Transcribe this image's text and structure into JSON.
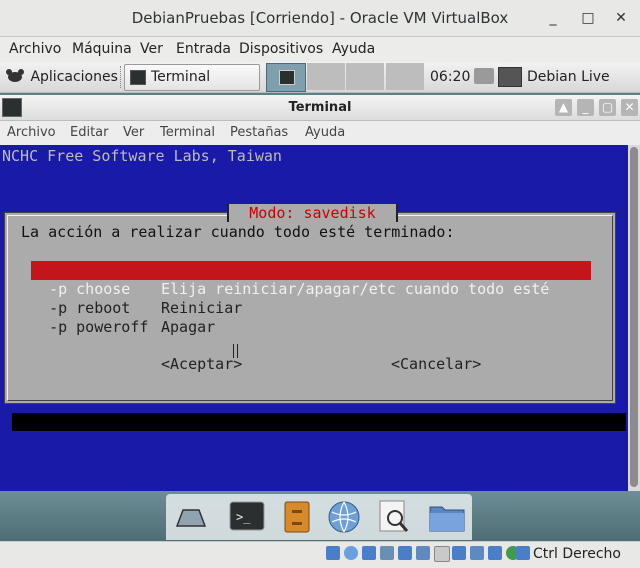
{
  "window": {
    "title": "DebianPruebas [Corriendo] - Oracle VM VirtualBox",
    "controls": [
      "_",
      "□",
      "✕"
    ]
  },
  "vbox_menu": [
    "Archivo",
    "Máquina",
    "Ver",
    "Entrada",
    "Dispositivos",
    "Ayuda"
  ],
  "panel": {
    "apps_label": "Aplicaciones",
    "task_label": "Terminal",
    "clock": "06:20",
    "user": "Debian Live user"
  },
  "terminal": {
    "title": "Terminal",
    "menu": [
      "Archivo",
      "Editar",
      "Ver",
      "Terminal",
      "Pestañas",
      "Ayuda"
    ]
  },
  "content": {
    "banner": "NCHC Free Software Labs, Taiwan",
    "dialog_title": "Modo: savedisk",
    "prompt": "La acción a realizar cuando todo esté terminado:",
    "options": [
      {
        "flag": "-p choose  ",
        "desc": "Elija reiniciar/apagar/etc cuando todo esté",
        "selected": true
      },
      {
        "flag": "-p reboot  ",
        "desc": "Reiniciar",
        "selected": false
      },
      {
        "flag": "-p poweroff",
        "desc": "Apagar",
        "selected": false
      }
    ],
    "accept": "<Aceptar>",
    "cancel": "<Cancelar>"
  },
  "statusbar": {
    "host_key": "Ctrl Derecho"
  },
  "colors": {
    "terminal_bg": "#1a1aa8",
    "dialog_bg": "#ababab",
    "selection": "#c4151c",
    "dialog_title": "#cc0000"
  }
}
